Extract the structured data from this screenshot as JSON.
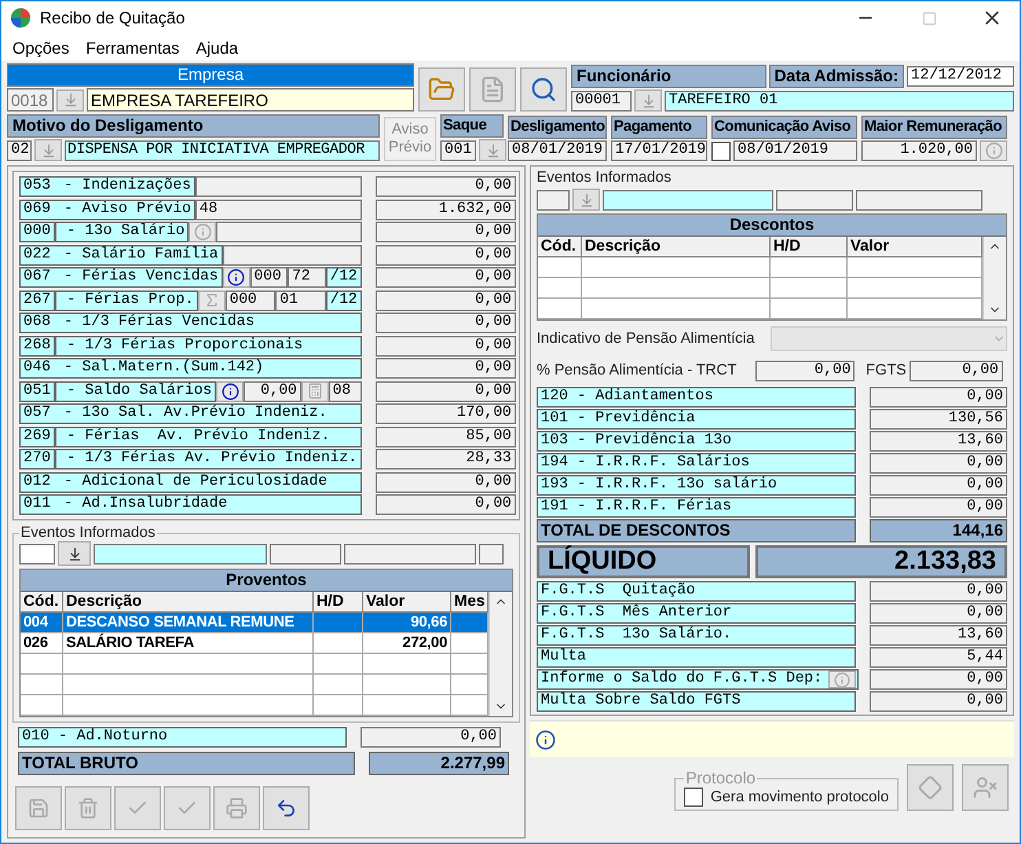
{
  "window": {
    "title": "Recibo de Quitação"
  },
  "menu": [
    "Opções",
    "Ferramentas",
    "Ajuda"
  ],
  "empresa": {
    "label": "Empresa",
    "code": "0018",
    "name": "EMPRESA TAREFEIRO"
  },
  "header_buttons": [
    {
      "kind": "open",
      "disabled": false
    },
    {
      "kind": "report",
      "disabled": true
    },
    {
      "kind": "preview",
      "disabled": false
    }
  ],
  "funcionario": {
    "label": "Funcionário",
    "admission_label": "Data Admissão:",
    "admission": "12/12/2012",
    "code": "00001",
    "name": "TAREFEIRO 01"
  },
  "motivo": {
    "label": "Motivo do Desligamento",
    "code": "02",
    "text": "DISPENSA POR INICIATIVA EMPREGADOR"
  },
  "aviso_button": {
    "label": "Aviso Prévio",
    "disabled": true
  },
  "saque": {
    "label": "Saque",
    "code": "001"
  },
  "desligamento": {
    "label": "Desligamento",
    "value": "08/01/2019"
  },
  "pagamento": {
    "label": "Pagamento",
    "value": "17/01/2019"
  },
  "comunicacao": {
    "label": "Comunicação Aviso",
    "checked": false,
    "value": "08/01/2019"
  },
  "maior_remuneracao": {
    "label": "Maior Remuneração",
    "value": "1.020,00"
  },
  "earnings": [
    {
      "code": "053",
      "description": "- Indenizações",
      "code_boxed": false,
      "extras": [
        {
          "kind": "field"
        }
      ],
      "value": "0,00"
    },
    {
      "code": "069",
      "description": "- Aviso Prévio",
      "code_boxed": false,
      "extras": [
        {
          "kind": "field",
          "text": "48"
        }
      ],
      "value": "1.632,00"
    },
    {
      "code": "000",
      "description": "- 13o Salário",
      "code_boxed": true,
      "extras": [
        {
          "kind": "info",
          "disabled": true
        },
        {
          "kind": "field"
        }
      ],
      "value": "0,00"
    },
    {
      "code": "022",
      "description": "- Salário Família",
      "code_boxed": false,
      "extras": [
        {
          "kind": "field"
        }
      ],
      "value": "0,00"
    },
    {
      "code": "067",
      "description": "- Férias Vencidas",
      "code_boxed": false,
      "extras": [
        {
          "kind": "info",
          "disabled": false
        },
        {
          "kind": "field",
          "text": "000"
        },
        {
          "kind": "field",
          "text": "72"
        },
        {
          "kind": "suffix",
          "text": "/12"
        }
      ],
      "value": "0,00"
    },
    {
      "code": "267",
      "description": "- Férias Prop.",
      "code_boxed": true,
      "extras": [
        {
          "kind": "function",
          "disabled": true
        },
        {
          "kind": "field",
          "text": "000"
        },
        {
          "kind": "field",
          "text": "01"
        },
        {
          "kind": "suffix",
          "text": "/12"
        }
      ],
      "value": "0,00"
    },
    {
      "code": "068",
      "description": "- 1/3 Férias Vencidas",
      "code_boxed": false,
      "value": "0,00"
    },
    {
      "code": "268",
      "description": "- 1/3 Férias Proporcionais",
      "code_boxed": true,
      "value": "0,00"
    },
    {
      "code": "046",
      "description": "- Sal.Matern.(Sum.142)",
      "code_boxed": false,
      "value": "0,00"
    },
    {
      "code": "051",
      "description": "- Saldo Salários",
      "code_boxed": true,
      "extras": [
        {
          "kind": "info",
          "disabled": false
        },
        {
          "kind": "number",
          "text": "0,00"
        },
        {
          "kind": "calc",
          "disabled": true
        },
        {
          "kind": "field",
          "text": "08"
        }
      ],
      "value": "0,00"
    },
    {
      "code": "057",
      "description": "- 13o Sal. Av.Prévio Indeniz.",
      "code_boxed": false,
      "value": "170,00"
    },
    {
      "code": "269",
      "description": " - Férias  Av. Prévio Indeniz.",
      "code_boxed": true,
      "value": "85,00"
    },
    {
      "code": "270",
      "description": " - 1/3 Férias Av. Prévio Indeniz.",
      "code_boxed": true,
      "value": "28,33"
    },
    {
      "code": "012",
      "description": "- Adicional de Periculosidade",
      "code_boxed": false,
      "value": "0,00"
    },
    {
      "code": "011",
      "description": "- Ad.Insalubridade",
      "code_boxed": false,
      "value": "0,00"
    }
  ],
  "eventos_left": {
    "title": "Eventos Informados",
    "table_title": "Proventos",
    "columns": [
      "Cód.",
      "Descrição",
      "H/D",
      "Valor",
      "Mes"
    ],
    "rows": [
      {
        "cod": "004",
        "descricao": "DESCANSO SEMANAL REMUNE",
        "valor": "90,66",
        "selected": true
      },
      {
        "cod": "026",
        "descricao": "SALÁRIO TAREFA",
        "valor": "272,00",
        "selected": false
      }
    ]
  },
  "noturno": {
    "label": "010 - Ad.Noturno",
    "value": "0,00"
  },
  "total_bruto": {
    "label": "TOTAL BRUTO",
    "value": "2.277,99"
  },
  "toolbar": [
    {
      "kind": "save",
      "disabled": true
    },
    {
      "kind": "delete",
      "disabled": true
    },
    {
      "kind": "check",
      "disabled": true
    },
    {
      "kind": "check",
      "disabled": true
    },
    {
      "kind": "print",
      "disabled": true
    },
    {
      "kind": "undo",
      "disabled": false
    }
  ],
  "eventos_right": {
    "title": "Eventos Informados",
    "table_title": "Descontos",
    "columns": [
      "Cód.",
      "Descrição",
      "H/D",
      "Valor"
    ]
  },
  "pensao_indicativo": {
    "label": "Indicativo de Pensão Alimentícia",
    "disabled": true
  },
  "pensao_trct": {
    "label": "% Pensão Alimentícia - TRCT",
    "value": "0,00",
    "fgts_label": "FGTS",
    "fgts_value": "0,00"
  },
  "deductions": [
    {
      "label": "120 - Adiantamentos",
      "value": "0,00"
    },
    {
      "label": "101 - Previdência",
      "value": "130,56"
    },
    {
      "label": "103 - Previdência 13o",
      "value": "13,60"
    },
    {
      "label": "194 - I.R.R.F. Salários",
      "value": "0,00"
    },
    {
      "label": "193 - I.R.R.F. 13o salário",
      "value": "0,00"
    },
    {
      "label": "191 - I.R.R.F. Férias",
      "value": "0,00"
    }
  ],
  "total_descontos": {
    "label": "TOTAL DE DESCONTOS",
    "value": "144,16"
  },
  "liquido": {
    "label": "LÍQUIDO",
    "value": "2.133,83"
  },
  "fgts": [
    {
      "label": "F.G.T.S  Quitação",
      "value": "0,00",
      "info_button": false
    },
    {
      "label": "F.G.T.S  Mês Anterior",
      "value": "0,00",
      "info_button": false
    },
    {
      "label": "F.G.T.S  13o Salário.",
      "value": "13,60",
      "info_button": false
    },
    {
      "label": "Multa",
      "value": "5,44",
      "info_button": false
    },
    {
      "label": "Informe o Saldo do F.G.T.S Dep:",
      "value": "0,00",
      "info_button": true
    },
    {
      "label": "Multa Sobre Saldo FGTS",
      "value": "0,00",
      "info_button": false
    }
  ],
  "protocolo": {
    "title": "Protocolo",
    "checkbox_label": "Gera movimento protocolo",
    "checked": false
  },
  "bottom_buttons": [
    {
      "kind": "diamond",
      "disabled": true
    },
    {
      "kind": "user-remove",
      "disabled": true
    }
  ]
}
